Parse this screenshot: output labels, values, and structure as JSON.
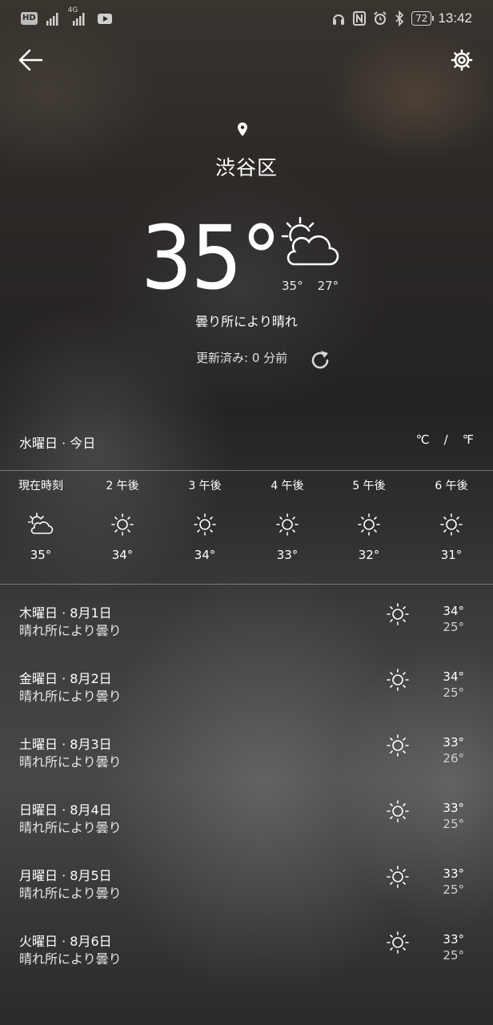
{
  "status_bar": {
    "badge": "HD",
    "network": "4G",
    "battery": "72",
    "time": "13:42"
  },
  "header": {
    "back_icon": "arrow-left-icon",
    "settings_icon": "gear-icon"
  },
  "current": {
    "location_icon": "location-pin-icon",
    "city": "渋谷区",
    "temperature": "35°",
    "icon": "partly-cloudy-icon",
    "high": "35°",
    "low": "27°",
    "condition": "曇り所により晴れ",
    "updated": "更新済み: 0 分前",
    "refresh_icon": "refresh-icon"
  },
  "today": {
    "label": "水曜日 · 今日",
    "unit_c": "℃",
    "unit_sep": "/",
    "unit_f": "℉"
  },
  "hourly": [
    {
      "time": "現在時刻",
      "icon": "partly-cloudy-icon",
      "temp": "35°"
    },
    {
      "time": "2 午後",
      "icon": "sun-icon",
      "temp": "34°"
    },
    {
      "time": "3 午後",
      "icon": "sun-icon",
      "temp": "34°"
    },
    {
      "time": "4 午後",
      "icon": "sun-icon",
      "temp": "33°"
    },
    {
      "time": "5 午後",
      "icon": "sun-icon",
      "temp": "32°"
    },
    {
      "time": "6 午後",
      "icon": "sun-icon",
      "temp": "31°"
    }
  ],
  "daily": [
    {
      "day": "木曜日 · 8月1日",
      "condition": "晴れ所により曇り",
      "icon": "sun-icon",
      "high": "34°",
      "low": "25°"
    },
    {
      "day": "金曜日 · 8月2日",
      "condition": "晴れ所により曇り",
      "icon": "sun-icon",
      "high": "34°",
      "low": "25°"
    },
    {
      "day": "土曜日 · 8月3日",
      "condition": "晴れ所により曇り",
      "icon": "sun-icon",
      "high": "33°",
      "low": "26°"
    },
    {
      "day": "日曜日 · 8月4日",
      "condition": "晴れ所により曇り",
      "icon": "sun-icon",
      "high": "33°",
      "low": "25°"
    },
    {
      "day": "月曜日 · 8月5日",
      "condition": "晴れ所により曇り",
      "icon": "sun-icon",
      "high": "33°",
      "low": "25°"
    },
    {
      "day": "火曜日 · 8月6日",
      "condition": "晴れ所により曇り",
      "icon": "sun-icon",
      "high": "33°",
      "low": "25°"
    }
  ]
}
